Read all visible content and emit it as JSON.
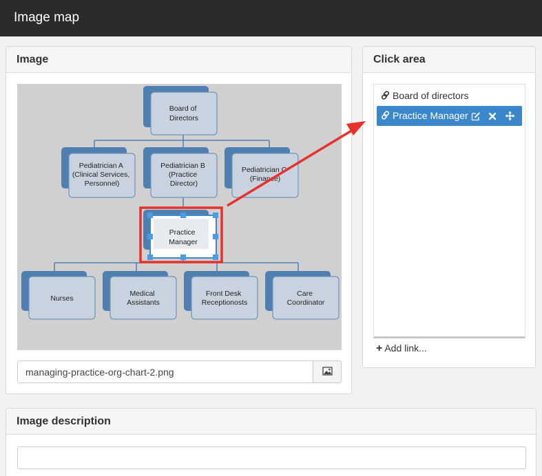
{
  "header": {
    "title": "Image map"
  },
  "image_panel": {
    "title": "Image",
    "filename": "managing-practice-org-chart-2.png",
    "chart_nodes": {
      "board": [
        "Board of",
        "Directors"
      ],
      "ped_a": [
        "Pediatrician A",
        "(Clinical Services,",
        "Personnel)"
      ],
      "ped_b": [
        "Pediatrician B",
        "(Practice",
        "Director)"
      ],
      "ped_c": [
        "Pediatrician C",
        "(Finance)"
      ],
      "manager": [
        "Practice",
        "Manager"
      ],
      "nurses": [
        "Nurses"
      ],
      "medical": [
        "Medical",
        "Assistants"
      ],
      "front": [
        "Front Desk",
        "Receptionosts"
      ],
      "care": [
        "Care",
        "Coordinator"
      ]
    }
  },
  "click_panel": {
    "title": "Click area",
    "links": [
      {
        "label": "Board of directors",
        "selected": false
      },
      {
        "label": "Practice Manager",
        "selected": true
      }
    ],
    "add_link": "Add link..."
  },
  "description_panel": {
    "title": "Image description",
    "value": ""
  },
  "colors": {
    "accent": "#3a87cb",
    "topbar": "#2b2b2b",
    "annotation": "#e8312a",
    "node_back": "#4e7fb0",
    "node_front": "#c9d3df"
  },
  "icons": [
    "link-icon",
    "edit-icon",
    "close-icon",
    "move-icon",
    "image-icon"
  ]
}
